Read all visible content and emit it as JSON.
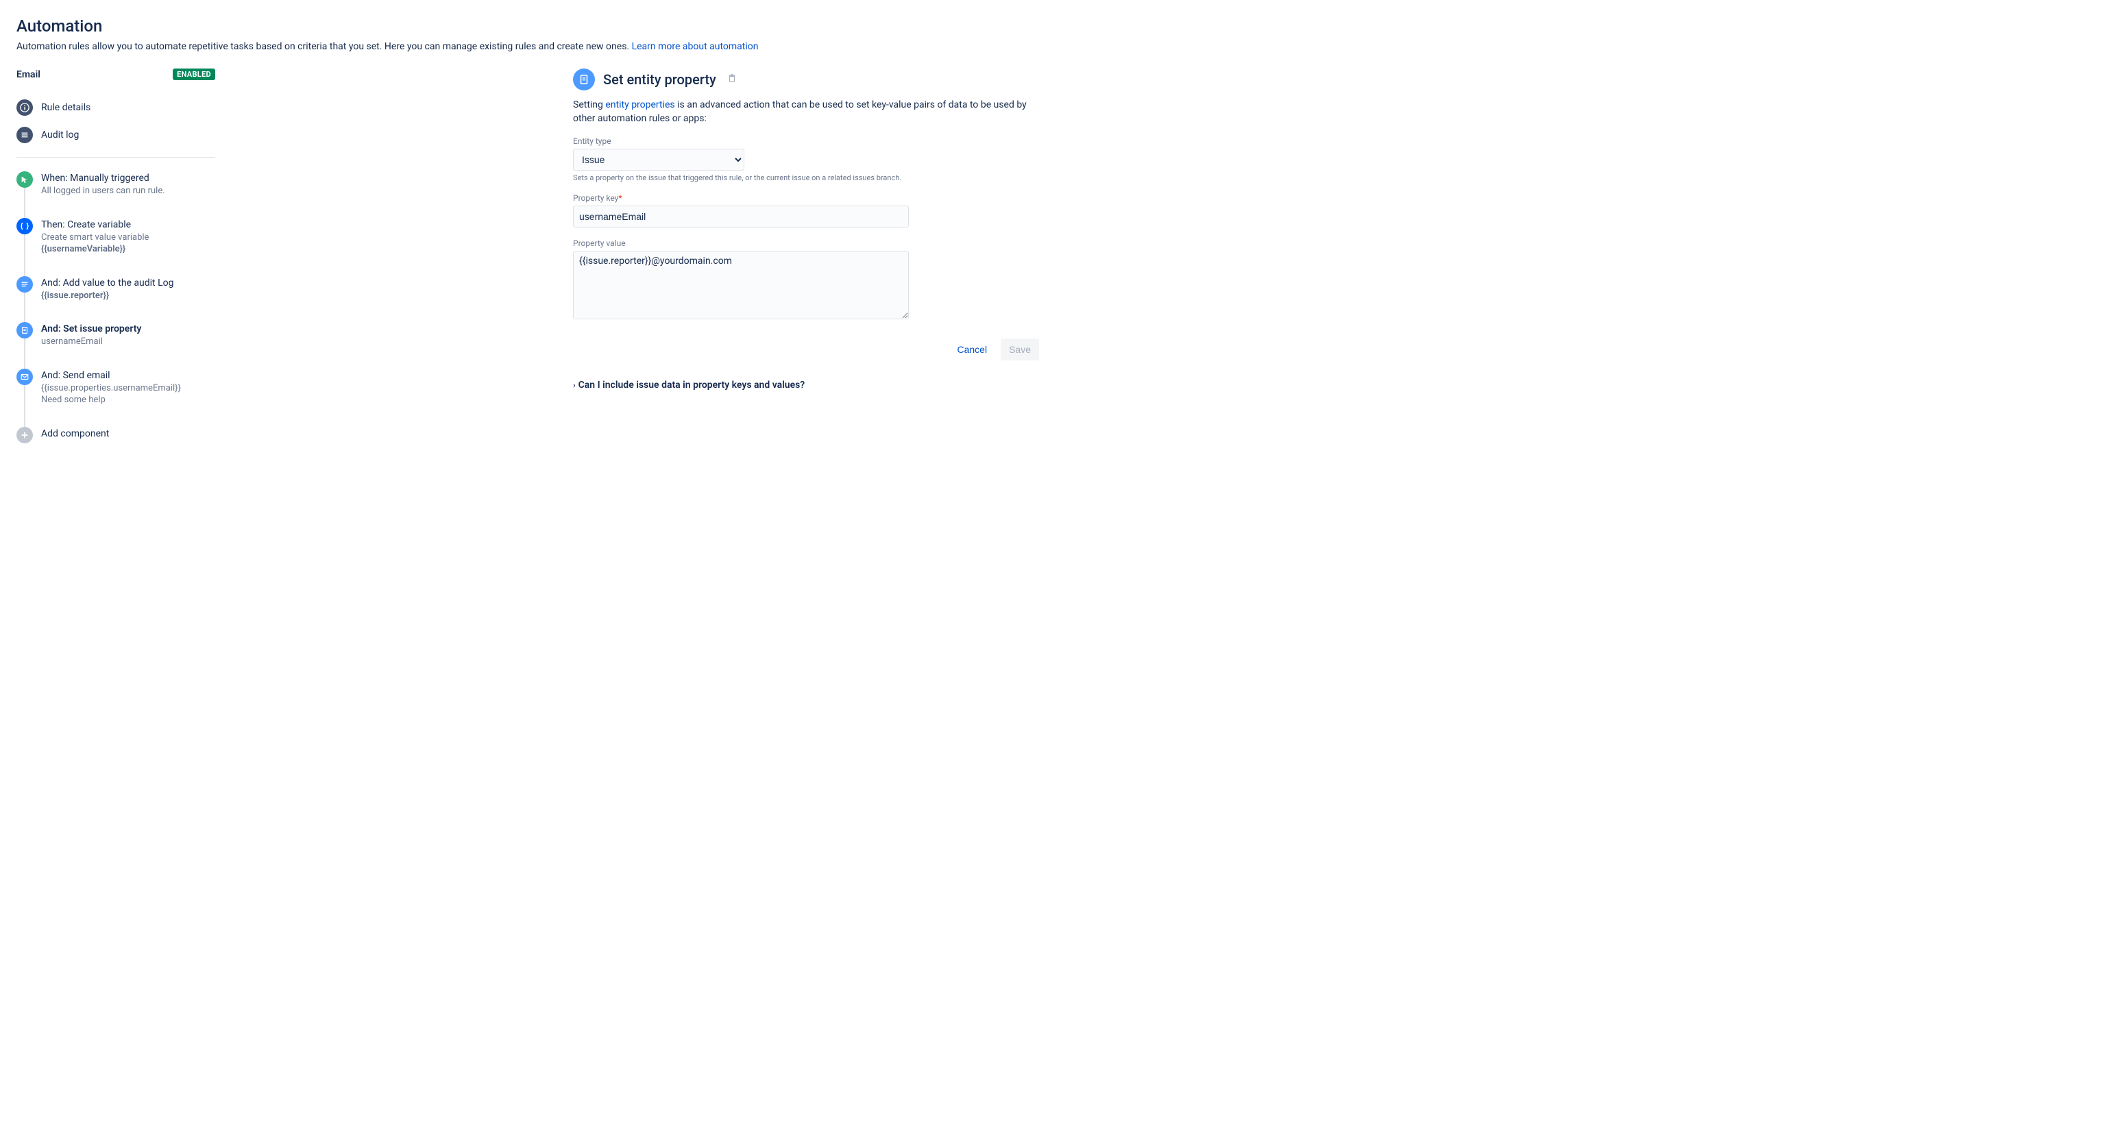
{
  "page": {
    "title": "Automation",
    "description_prefix": "Automation rules allow you to automate repetitive tasks based on criteria that you set. Here you can manage existing rules and create new ones. ",
    "learn_more": "Learn more about automation"
  },
  "rule": {
    "name": "Email",
    "status": "ENABLED"
  },
  "nav": {
    "rule_details": "Rule details",
    "audit_log": "Audit log"
  },
  "steps": [
    {
      "title": "When: Manually triggered",
      "sub1": "All logged in users can run rule.",
      "sub2": ""
    },
    {
      "title": "Then: Create variable",
      "sub1": "Create smart value variable",
      "sub2": "{{usernameVariable}}"
    },
    {
      "title": "And: Add value to the audit Log",
      "sub1": "{{issue.reporter}}",
      "sub2": ""
    },
    {
      "title": "And: Set issue property",
      "sub1": "usernameEmail",
      "sub2": ""
    },
    {
      "title": "And: Send email",
      "sub1": "{{issue.properties.usernameEmail}}",
      "sub2": "Need some help"
    }
  ],
  "add_component": "Add component",
  "panel": {
    "title": "Set entity property",
    "desc_prefix": "Setting ",
    "desc_link": "entity properties",
    "desc_suffix": " is an advanced action that can be used to set key-value pairs of data to be used by other automation rules or apps:",
    "entity_type_label": "Entity type",
    "entity_type_value": "Issue",
    "entity_type_help": "Sets a property on the issue that triggered this rule, or the current issue on a related issues branch.",
    "property_key_label": "Property key",
    "property_key_value": "usernameEmail",
    "property_value_label": "Property value",
    "property_value_value": "{{issue.reporter}}@yourdomain.com",
    "cancel": "Cancel",
    "save": "Save",
    "faq": "Can I include issue data in property keys and values?"
  }
}
